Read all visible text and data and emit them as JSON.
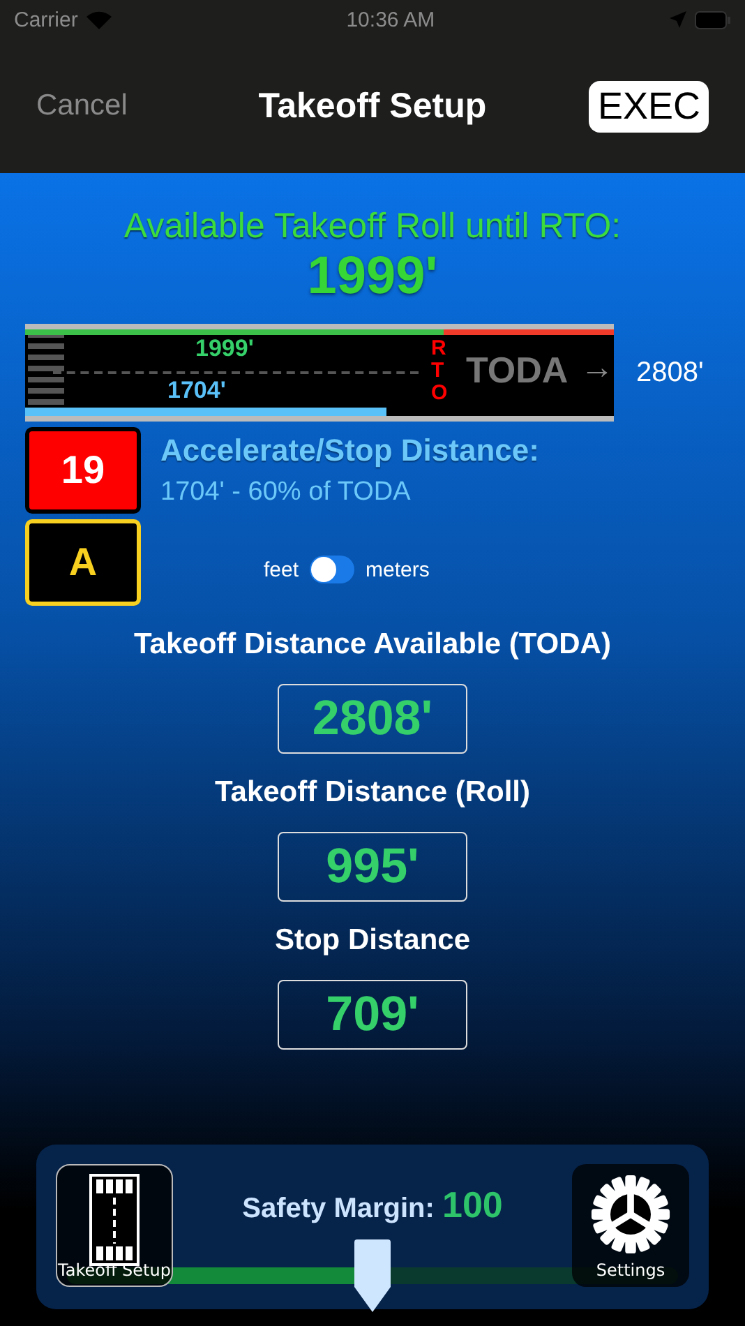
{
  "status_bar": {
    "carrier": "Carrier",
    "time": "10:36 AM"
  },
  "nav": {
    "cancel": "Cancel",
    "title": "Takeoff Setup",
    "exec": "EXEC"
  },
  "roll_header": {
    "label": "Available Takeoff Roll until RTO:",
    "value": "1999'"
  },
  "runway": {
    "rto_distance": "1999'",
    "rto_bar": {
      "level": 0.712
    },
    "accel_stop": "1704'",
    "accel_stop_bar": {
      "level": 0.607
    },
    "rto_letters": [
      "R",
      "T",
      "O"
    ],
    "toda_label": "TODA",
    "arrow": "→",
    "toda_value": "2808'"
  },
  "runway_sign": {
    "number": "19",
    "letter": "A"
  },
  "accelerate_stop": {
    "title": "Accelerate/Stop Distance:",
    "detail": "1704' - 60% of TODA"
  },
  "units": {
    "left": "feet",
    "right": "meters",
    "on": false
  },
  "values": [
    {
      "label": "Takeoff Distance Available (TODA)",
      "value": "2808'"
    },
    {
      "label": "Takeoff Distance (Roll)",
      "value": "995'"
    },
    {
      "label": "Stop Distance",
      "value": "709'"
    }
  ],
  "safety_margin": {
    "label": "Safety Margin:",
    "value": "100",
    "level": 0.5
  },
  "dock": [
    {
      "label": "Takeoff Setup",
      "kind": "runway",
      "selected": true
    },
    {
      "label": "Settings",
      "kind": "gear",
      "selected": false
    }
  ]
}
